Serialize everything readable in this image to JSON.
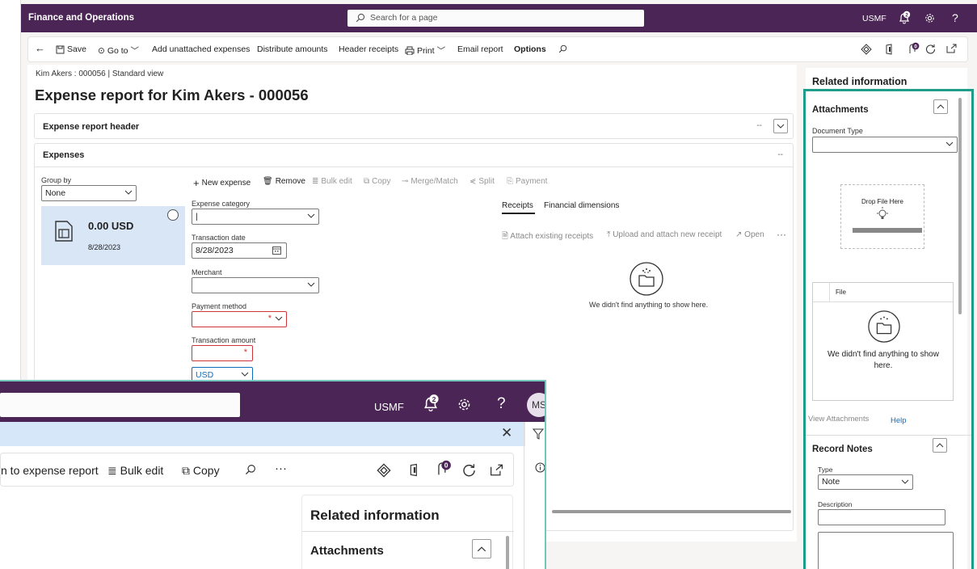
{
  "topbar": {
    "app_title": "Finance and Operations",
    "search_placeholder": "Search for a page",
    "company": "USMF",
    "notification_count": "2",
    "help": "?"
  },
  "action_pane": {
    "back": "←",
    "save": "Save",
    "go_to": "Go to",
    "add_unattached": "Add unattached expenses",
    "distribute": "Distribute amounts",
    "header_receipts": "Header receipts",
    "print": "Print",
    "email_report": "Email report",
    "options": "Options",
    "attach_count": "0"
  },
  "main": {
    "breadcrumb": "Kim Akers : 000056  |  Standard view",
    "title": "Expense report for Kim Akers - 000056",
    "header_tab": "Expense report header",
    "header_dash": "--",
    "expenses_tab": "Expenses",
    "expenses_dash": "--"
  },
  "group_by": {
    "label": "Group by",
    "value": "None"
  },
  "expense_card": {
    "amount": "0.00 USD",
    "date": "8/28/2023"
  },
  "lines_toolbar": {
    "new_expense": "New expense",
    "remove": "Remove",
    "bulk_edit": "Bulk edit",
    "copy": "Copy",
    "merge_match": "Merge/Match",
    "split": "Split",
    "payment": "Payment"
  },
  "form": {
    "category_label": "Expense category",
    "category_value": "|",
    "date_label": "Transaction date",
    "date_value": "8/28/2023",
    "merchant_label": "Merchant",
    "payment_label": "Payment method",
    "amount_label": "Transaction amount",
    "currency_value": "USD",
    "required_mark": "*"
  },
  "receipts": {
    "tab_receipts": "Receipts",
    "tab_financial": "Financial dimensions",
    "attach_existing": "Attach existing receipts",
    "upload_new": "Upload and attach new receipt",
    "open": "Open",
    "more": "···",
    "empty_message": "We didn't find anything to show here."
  },
  "related": {
    "title": "Related information",
    "attachments_title": "Attachments",
    "document_type_label": "Document Type",
    "drop_file": "Drop File Here",
    "file_column": "File",
    "empty_message": "We didn't find anything to show here.",
    "view_attachments": "View Attachments",
    "help": "Help",
    "notes_title": "Record Notes",
    "type_label": "Type",
    "type_value": "Note",
    "description_label": "Description"
  },
  "overlay": {
    "company": "USMF",
    "notification_count": "2",
    "help": "?",
    "user_initials": "MS",
    "add_to_report": "n to expense report",
    "bulk_edit": "Bulk edit",
    "copy": "Copy",
    "more": "···",
    "attach_count": "0",
    "related_title": "Related information",
    "attachments_title": "Attachments"
  },
  "colors": {
    "nav_purple": "#4b2555",
    "accent_teal": "#1e9e8a",
    "link_blue": "#0f6cbd",
    "required_red": "#d13438",
    "card_blue": "#d8e6f6"
  }
}
